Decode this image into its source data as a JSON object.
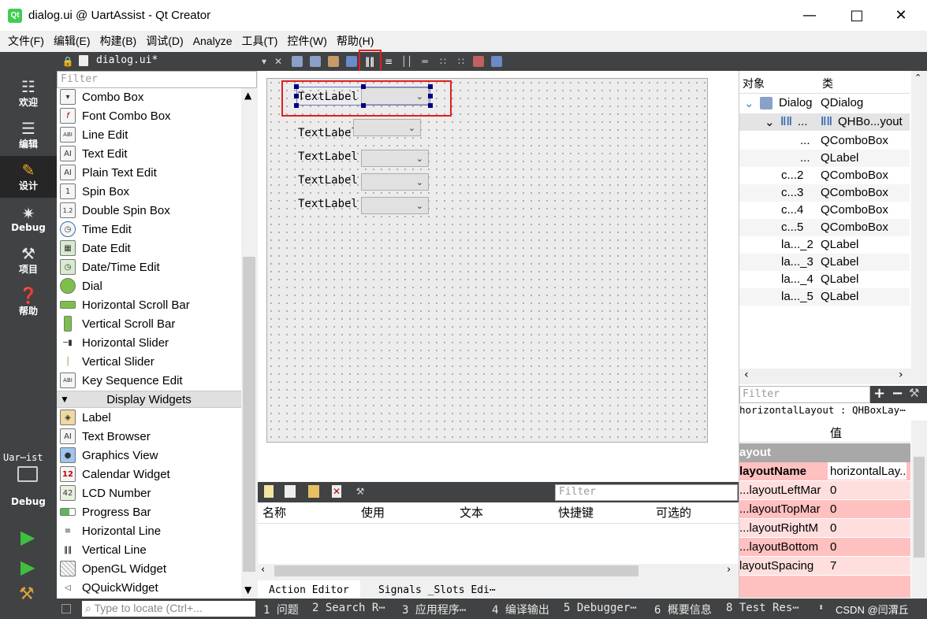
{
  "window": {
    "title": "dialog.ui @ UartAssist - Qt Creator",
    "app_icon": "Qt"
  },
  "menu": [
    "文件(F)",
    "编辑(E)",
    "构建(B)",
    "调试(D)",
    "Analyze",
    "工具(T)",
    "控件(W)",
    "帮助(H)"
  ],
  "doc_tab": "dialog.ui*",
  "modes": [
    {
      "label": "欢迎",
      "icon": "grid-icon"
    },
    {
      "label": "编辑",
      "icon": "document-icon"
    },
    {
      "label": "设计",
      "icon": "pencil-icon"
    },
    {
      "label": "Debug",
      "icon": "bug-icon"
    },
    {
      "label": "项目",
      "icon": "wrench-icon"
    },
    {
      "label": "帮助",
      "icon": "help-icon"
    }
  ],
  "kit": {
    "label": "Uar⋯ist",
    "sub": "Debug"
  },
  "widget_box": {
    "filter_placeholder": "Filter",
    "items": [
      "Combo Box",
      "Font Combo Box",
      "Line Edit",
      "Text Edit",
      "Plain Text Edit",
      "Spin Box",
      "Double Spin Box",
      "Time Edit",
      "Date Edit",
      "Date/Time Edit",
      "Dial",
      "Horizontal Scroll Bar",
      "Vertical Scroll Bar",
      "Horizontal Slider",
      "Vertical Slider",
      "Key Sequence Edit"
    ],
    "category": "Display Widgets",
    "display_items": [
      "Label",
      "Text Browser",
      "Graphics View",
      "Calendar Widget",
      "LCD Number",
      "Progress Bar",
      "Horizontal Line",
      "Vertical Line",
      "OpenGL Widget",
      "QQuickWidget"
    ]
  },
  "form": {
    "labels": [
      "TextLabel",
      "TextLabel",
      "TextLabel",
      "TextLabel",
      "TextLabel"
    ]
  },
  "action_editor": {
    "filter_placeholder": "Filter",
    "columns": [
      "名称",
      "使用",
      "文本",
      "快捷键",
      "可选的"
    ],
    "tabs": [
      "Action Editor",
      "Signals _Slots Edi⋯"
    ]
  },
  "object_inspector": {
    "headers": [
      "对象",
      "类"
    ],
    "rows": [
      {
        "obj": "Dialog",
        "cls": "QDialog"
      },
      {
        "obj": "...",
        "cls": "QHBo...yout"
      },
      {
        "obj": "...",
        "cls": "QComboBox"
      },
      {
        "obj": "...",
        "cls": "QLabel"
      },
      {
        "obj": "c...2",
        "cls": "QComboBox"
      },
      {
        "obj": "c...3",
        "cls": "QComboBox"
      },
      {
        "obj": "c...4",
        "cls": "QComboBox"
      },
      {
        "obj": "c...5",
        "cls": "QComboBox"
      },
      {
        "obj": "la..._2",
        "cls": "QLabel"
      },
      {
        "obj": "la..._3",
        "cls": "QLabel"
      },
      {
        "obj": "la..._4",
        "cls": "QLabel"
      },
      {
        "obj": "la..._5",
        "cls": "QLabel"
      }
    ]
  },
  "property_editor": {
    "filter_placeholder": "Filter",
    "object_line": "horizontalLayout : QHBoxLay⋯",
    "value_header": "值",
    "section": "ayout",
    "rows": [
      {
        "k": "layoutName",
        "v": "horizontalLay..."
      },
      {
        "k": "layoutLeftMar...",
        "v": "0"
      },
      {
        "k": "layoutTopMar...",
        "v": "0"
      },
      {
        "k": "layoutRightM...",
        "v": "0"
      },
      {
        "k": "layoutBottom...",
        "v": "0"
      },
      {
        "k": "layoutSpacing",
        "v": "7"
      }
    ]
  },
  "status": {
    "locate_placeholder": "Type to locate (Ctrl+...",
    "panes": [
      "1 问题",
      "2 Search R⋯",
      "3 应用程序⋯",
      "4 编译输出",
      "5 Debugger⋯",
      "6 概要信息",
      "8 Test Res⋯"
    ],
    "watermark": "CSDN @闫渭丘"
  },
  "colors": {
    "dark": "#404244",
    "accent": "#e02020",
    "prop_pink": "#ffc0c0"
  }
}
